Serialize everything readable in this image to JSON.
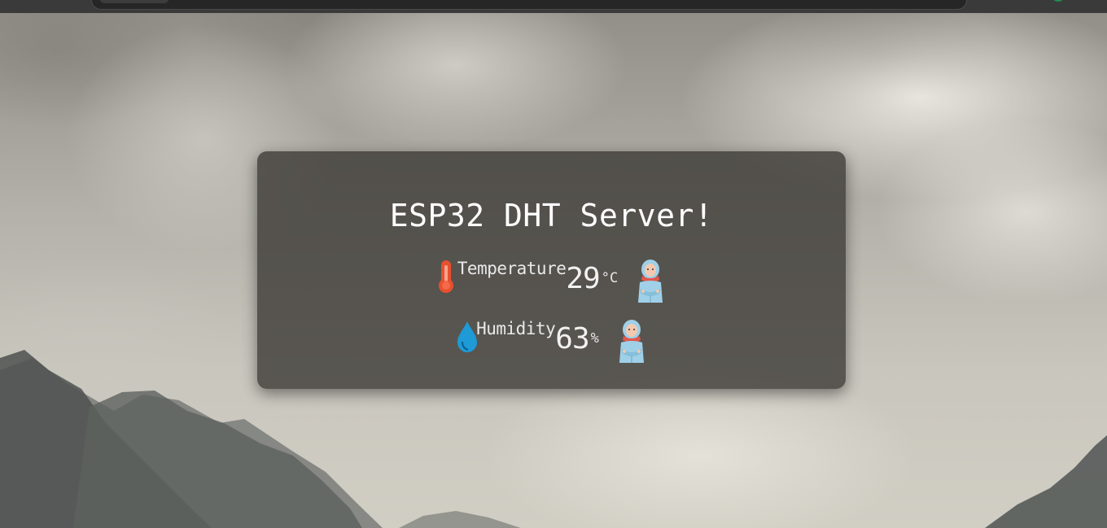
{
  "page": {
    "title": "ESP32 DHT Server!"
  },
  "readings": {
    "temperature": {
      "label": "Temperature",
      "value": "29",
      "unit": "°C",
      "icon": "thermometer-icon",
      "status_icon": "cold-person-icon"
    },
    "humidity": {
      "label": "Humidity",
      "value": "63",
      "unit": "%",
      "icon": "water-drop-icon",
      "status_icon": "cold-person-icon"
    }
  },
  "colors": {
    "card_background": "#3c3a36",
    "thermometer": "#e8502f",
    "water_drop": "#1e9ad6",
    "person_jacket": "#9fd0e8",
    "person_scarf": "#e2574c"
  }
}
